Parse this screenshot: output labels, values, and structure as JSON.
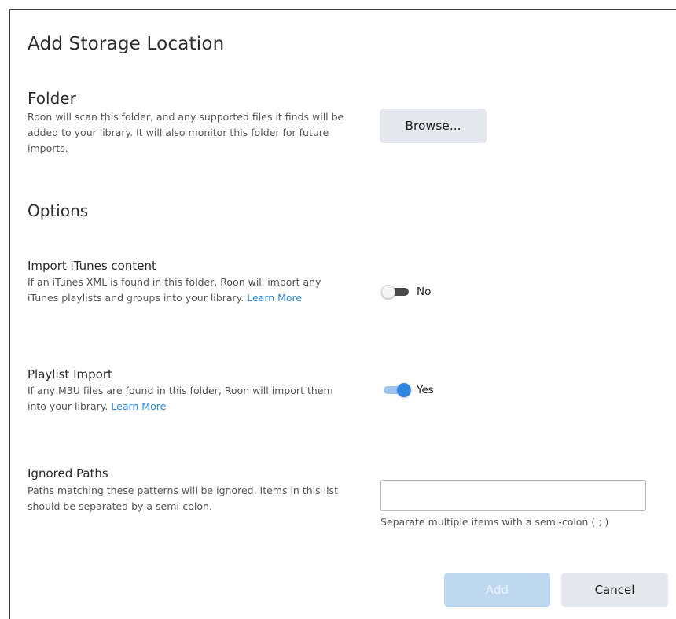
{
  "dialog": {
    "title": "Add Storage Location"
  },
  "folder": {
    "heading": "Folder",
    "description": "Roon will scan this folder, and any supported files it finds will be added to your library. It will also monitor this folder for future imports.",
    "browse_label": "Browse..."
  },
  "options": {
    "heading": "Options",
    "itunes": {
      "label": "Import iTunes content",
      "description": "If an iTunes XML is found in this folder, Roon will import any iTunes playlists and groups into your library.",
      "link": "Learn More",
      "state": "No",
      "enabled": false
    },
    "playlist": {
      "label": "Playlist Import",
      "description": "If any M3U files are found in this folder, Roon will import them into your library.",
      "link": "Learn More",
      "state": "Yes",
      "enabled": true
    },
    "ignored_paths": {
      "label": "Ignored Paths",
      "description": "Paths matching these patterns will be ignored. Items in this list should be separated by a semi-colon.",
      "value": "",
      "placeholder": "",
      "hint": "Separate multiple items with a semi-colon ( ; )"
    }
  },
  "actions": {
    "add_label": "Add",
    "cancel_label": "Cancel"
  },
  "colors": {
    "accent": "#2f86e0",
    "link": "#2f86d6",
    "button_bg": "#e4e8ee",
    "add_disabled_bg": "#bed8f2"
  }
}
